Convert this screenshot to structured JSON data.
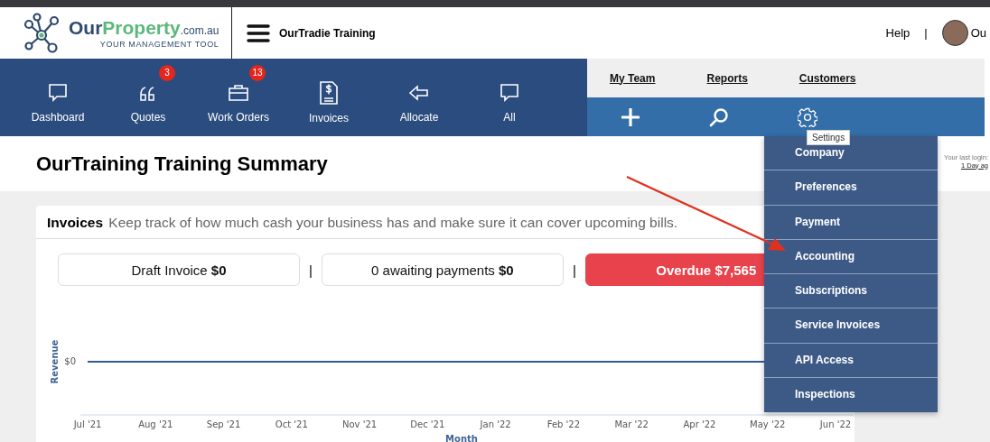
{
  "header": {
    "logo": {
      "name_first": "Our",
      "name_second": "Property",
      "domain": ".com.au",
      "tagline": "YOUR MANAGEMENT TOOL"
    },
    "company": "OurTradie Training",
    "help": "Help",
    "separator": "|",
    "user": "Ou"
  },
  "nav": [
    {
      "kind": "chat",
      "label": "Dashboard"
    },
    {
      "kind": "quotes",
      "label": "Quotes",
      "badge": "3"
    },
    {
      "kind": "briefcase",
      "label": "Work Orders",
      "badge": "13"
    },
    {
      "kind": "invoice",
      "label": "Invoices"
    },
    {
      "kind": "arrow",
      "label": "Allocate"
    },
    {
      "kind": "chat",
      "label": "All"
    }
  ],
  "links": [
    "My Team",
    "Reports",
    "Customers"
  ],
  "tools": [
    {
      "kind": "plus"
    },
    {
      "kind": "search"
    },
    {
      "kind": "gear"
    }
  ],
  "tooltip": "Settings",
  "settings_menu": [
    "Company",
    "Preferences",
    "Payment",
    "Accounting",
    "Subscriptions",
    "Service Invoices",
    "API Access",
    "Inspections"
  ],
  "page_title": "OurTraining Training Summary",
  "last_login": {
    "label": "Your last login:",
    "value": "1 Day ag"
  },
  "card": {
    "title": "Invoices",
    "subtitle": "Keep track of how much cash your business has and make sure it can cover upcoming bills.",
    "stats": [
      {
        "kind": "plain",
        "text": "Draft Invoice",
        "amount": "$0"
      },
      {
        "kind": "plain",
        "text": "0 awaiting payments",
        "amount": "$0"
      },
      {
        "kind": "alert",
        "text": "Overdue",
        "amount": "$7,565"
      }
    ],
    "stat_separator": "|",
    "chart": {
      "xlabel": "Month",
      "ylabel": "Revenue",
      "y_tick": "$0",
      "months": [
        "Jul '21",
        "Aug '21",
        "Sep '21",
        "Oct '21",
        "Nov '21",
        "Dec '21",
        "Jan '22",
        "Feb '22",
        "Mar '22",
        "Apr '22",
        "May '22",
        "Jun '22"
      ]
    }
  }
}
